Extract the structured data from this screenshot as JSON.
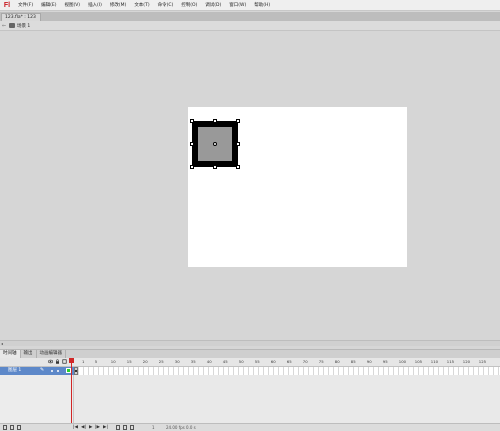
{
  "app": {
    "logo": "Fl"
  },
  "menu": [
    "文件(F)",
    "编辑(E)",
    "视图(V)",
    "插入(I)",
    "修改(M)",
    "文本(T)",
    "命令(C)",
    "控制(O)",
    "调试(D)",
    "窗口(W)",
    "帮助(H)"
  ],
  "document_tab": {
    "label": "123.fla* : 123"
  },
  "scene": {
    "label": "场景 1",
    "back": "⇐"
  },
  "panel_tabs": [
    "时间轴",
    "输出",
    "动画编辑器"
  ],
  "timeline": {
    "ruler_labels": [
      "1",
      "5",
      "10",
      "15",
      "20",
      "25",
      "30",
      "35",
      "40",
      "45",
      "50",
      "55",
      "60",
      "65",
      "70",
      "75",
      "80",
      "85",
      "90",
      "95",
      "100",
      "105",
      "110",
      "115",
      "120",
      "125"
    ],
    "layer": {
      "name": "图层 1"
    }
  },
  "footer": {
    "frame": "1",
    "fps": "24.00 fps",
    "time": "0.0 s",
    "playback": [
      "|◀",
      "◀|",
      "▶",
      "|▶",
      "▶|"
    ]
  },
  "colors": {
    "fill": "#999999",
    "stroke": "#000000",
    "stage": "#ffffff",
    "layer_highlight": "#5d88c9",
    "playhead": "#d12727"
  }
}
